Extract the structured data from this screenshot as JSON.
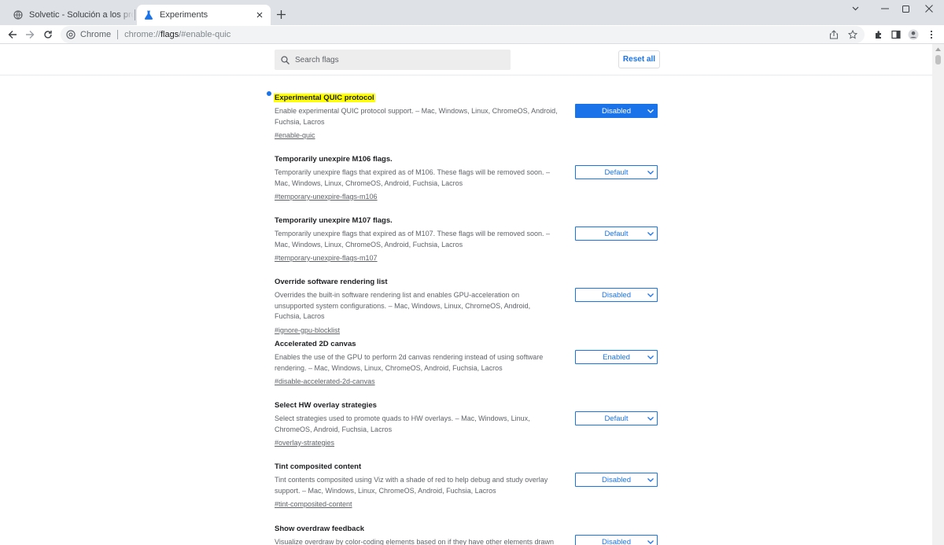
{
  "tabs": [
    {
      "title": "Solvetic - Solución a los problemas informáticos",
      "favicon": "globe-icon",
      "active": false
    },
    {
      "title": "Experiments",
      "favicon": "flask-icon",
      "active": true
    }
  ],
  "toolbar": {
    "site_label": "Chrome",
    "url_prefix": "chrome://",
    "url_path": "flags",
    "url_hash": "/#enable-quic"
  },
  "flags_page": {
    "search_placeholder": "Search flags",
    "reset_label": "Reset all"
  },
  "flags": [
    {
      "title": "Experimental QUIC protocol",
      "description": "Enable experimental QUIC protocol support. – Mac, Windows, Linux, ChromeOS, Android, Fuchsia, Lacros",
      "link": "#enable-quic",
      "state": "Disabled",
      "highlighted": true,
      "modified": true
    },
    {
      "title": "Temporarily unexpire M106 flags.",
      "description": "Temporarily unexpire flags that expired as of M106. These flags will be removed soon. – Mac, Windows, Linux, ChromeOS, Android, Fuchsia, Lacros",
      "link": "#temporary-unexpire-flags-m106",
      "state": "Default",
      "highlighted": false,
      "modified": false
    },
    {
      "title": "Temporarily unexpire M107 flags.",
      "description": "Temporarily unexpire flags that expired as of M107. These flags will be removed soon. – Mac, Windows, Linux, ChromeOS, Android, Fuchsia, Lacros",
      "link": "#temporary-unexpire-flags-m107",
      "state": "Default",
      "highlighted": false,
      "modified": false
    },
    {
      "title": "Override software rendering list",
      "description": "Overrides the built-in software rendering list and enables GPU-acceleration on unsupported system configurations. – Mac, Windows, Linux, ChromeOS, Android, Fuchsia, Lacros",
      "link": "#ignore-gpu-blocklist",
      "state": "Disabled",
      "highlighted": false,
      "modified": false
    },
    {
      "title": "Accelerated 2D canvas",
      "description": "Enables the use of the GPU to perform 2d canvas rendering instead of using software rendering. – Mac, Windows, Linux, ChromeOS, Android, Fuchsia, Lacros",
      "link": "#disable-accelerated-2d-canvas",
      "state": "Enabled",
      "highlighted": false,
      "modified": false
    },
    {
      "title": "Select HW overlay strategies",
      "description": "Select strategies used to promote quads to HW overlays. – Mac, Windows, Linux, ChromeOS, Android, Fuchsia, Lacros",
      "link": "#overlay-strategies",
      "state": "Default",
      "highlighted": false,
      "modified": false
    },
    {
      "title": "Tint composited content",
      "description": "Tint contents composited using Viz with a shade of red to help debug and study overlay support. – Mac, Windows, Linux, ChromeOS, Android, Fuchsia, Lacros",
      "link": "#tint-composited-content",
      "state": "Disabled",
      "highlighted": false,
      "modified": false
    },
    {
      "title": "Show overdraw feedback",
      "description": "Visualize overdraw by color-coding elements based on if they have other elements drawn",
      "link": "",
      "state": "Disabled",
      "highlighted": false,
      "modified": false
    }
  ],
  "colors": {
    "accent": "#1a73e8",
    "highlight": "#ffff00",
    "tabstrip": "#dee1e6"
  }
}
